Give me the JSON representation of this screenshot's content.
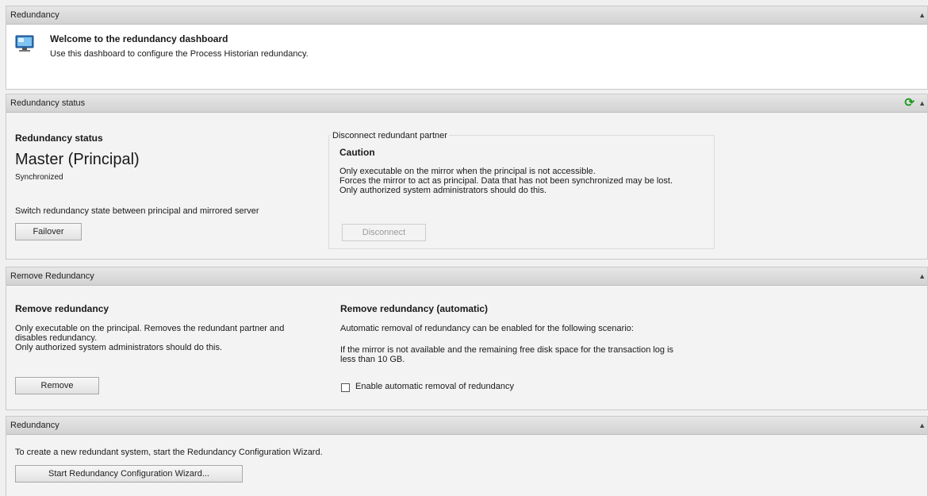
{
  "welcome": {
    "header": "Redundancy",
    "title": "Welcome to the redundancy dashboard",
    "description": "Use this dashboard to configure the Process Historian redundancy."
  },
  "status": {
    "header": "Redundancy status",
    "section_title": "Redundancy status",
    "state": "Master (Principal)",
    "sync": "Synchronized",
    "switch_label": "Switch redundancy state between principal and mirrored server",
    "failover_button": "Failover",
    "disconnect_group_title": "Disconnect redundant partner",
    "caution_title": "Caution",
    "caution_line1": "Only executable on the mirror when the principal is not accessible.",
    "caution_line2": "Forces the mirror to act as principal. Data that has not been synchronized may be lost.",
    "caution_line3": "Only authorized system administrators should do this.",
    "disconnect_button": "Disconnect"
  },
  "remove": {
    "header": "Remove Redundancy",
    "title": "Remove redundancy",
    "line1": "Only executable on the principal. Removes the redundant partner and",
    "line2": "disables redundancy.",
    "line3": "Only authorized system administrators should do this.",
    "remove_button": "Remove",
    "auto_title": "Remove redundancy (automatic)",
    "auto_line1": "Automatic removal of redundancy can be enabled for the following scenario:",
    "auto_line2": "If the mirror is not available and the remaining free disk space for the transaction log is",
    "auto_line3": "less than 10 GB.",
    "auto_checkbox_label": "Enable automatic removal of redundancy",
    "auto_checkbox_checked": false
  },
  "wizard": {
    "header": "Redundancy",
    "description": "To create a new redundant system, start the Redundancy Configuration Wizard.",
    "start_button": "Start Redundancy Configuration Wizard..."
  },
  "icons": {
    "collapse": "collapse-up-icon",
    "refresh": "refresh-icon",
    "dashboard": "monitor-icon"
  },
  "colors": {
    "header_bg": "#d9d9d9",
    "refresh_green": "#1a9a1a"
  }
}
